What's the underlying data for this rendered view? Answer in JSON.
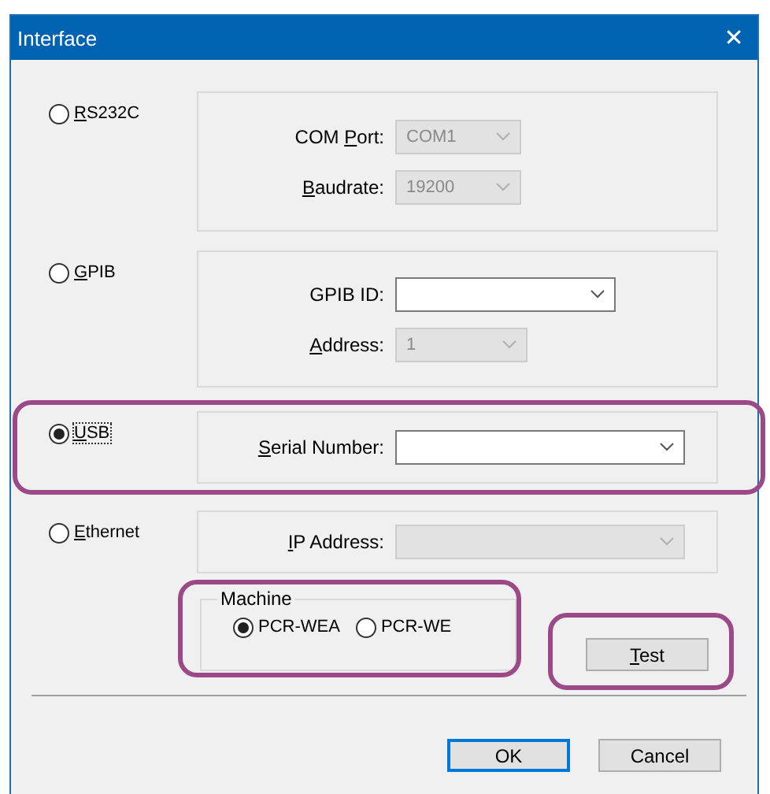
{
  "window": {
    "title": "Interface",
    "close": "✕"
  },
  "connections": [
    {
      "label": {
        "key": "R",
        "after": "S232C"
      },
      "selected": false,
      "highlighted": false,
      "fields": [
        {
          "label": {
            "before": "COM ",
            "key": "P",
            "after": "ort:"
          },
          "value": "COM1",
          "disabled": true
        },
        {
          "label": {
            "key": "B",
            "after": "audrate:"
          },
          "value": "19200",
          "disabled": true
        }
      ]
    },
    {
      "label": {
        "key": "G",
        "after": "PIB"
      },
      "selected": false,
      "highlighted": false,
      "fields": [
        {
          "label": {
            "before": "GPIB ID:"
          },
          "disabled": false
        },
        {
          "label": {
            "key": "A",
            "after": "ddress:"
          },
          "value": "1",
          "disabled": true
        }
      ]
    },
    {
      "label": {
        "key": "U",
        "after": "SB"
      },
      "selected": true,
      "highlighted": true,
      "fields": [
        {
          "label": {
            "key": "S",
            "after": "erial Number:"
          },
          "disabled": false
        }
      ]
    },
    {
      "label": {
        "key": "E",
        "after": "thernet"
      },
      "selected": false,
      "highlighted": false,
      "fields": [
        {
          "label": {
            "key": "I",
            "after": "P Address:"
          },
          "disabled": true
        }
      ]
    }
  ],
  "machine": {
    "title": "Machine",
    "highlighted": true,
    "options": [
      {
        "label": "PCR-WEA",
        "selected": true
      },
      {
        "label": "PCR-WE",
        "selected": false
      }
    ]
  },
  "test_button": {
    "label": {
      "key": "T",
      "after": "est"
    },
    "highlighted": true
  },
  "buttons": [
    {
      "label": "OK",
      "default": true
    },
    {
      "label": "Cancel",
      "default": false
    }
  ]
}
